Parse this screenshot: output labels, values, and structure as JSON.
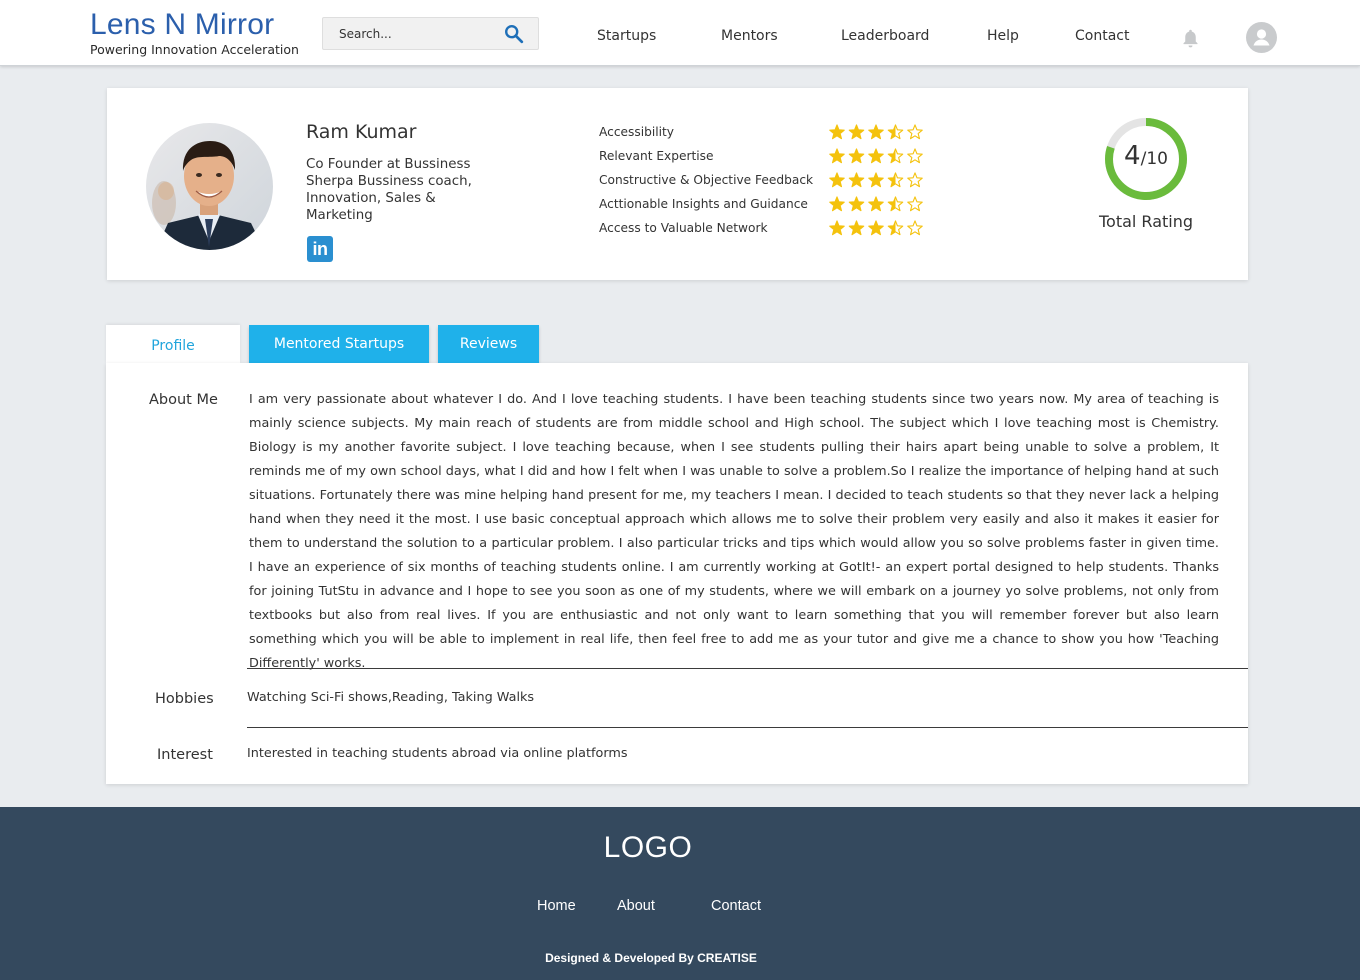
{
  "header": {
    "brand_title": "Lens N Mirror",
    "brand_tagline": "Powering Innovation Acceleration",
    "search_placeholder": "Search...",
    "search_icon": "search-icon",
    "nav": [
      "Startups",
      "Mentors",
      "Leaderboard",
      "Help",
      "Contact"
    ],
    "notification_icon": "bell-icon",
    "profile_icon": "user-avatar-icon",
    "brand_color": "#2b5fac"
  },
  "profile": {
    "name": "Ram Kumar",
    "role": "Co Founder at Bussiness Sherpa Bussiness coach, Innovation, Sales & Marketing",
    "linkedin_text": "in",
    "linkedin_icon": "linkedin-icon",
    "criteria": [
      {
        "label": "Accessibility",
        "stars": 3.5,
        "max": 5
      },
      {
        "label": "Relevant Expertise",
        "stars": 3.5,
        "max": 5
      },
      {
        "label": "Constructive & Objective Feedback",
        "stars": 3.5,
        "max": 5
      },
      {
        "label": "Acttionable Insights and Guidance",
        "stars": 3.5,
        "max": 5
      },
      {
        "label": "Access to Valuable Network",
        "stars": 3.5,
        "max": 5
      }
    ],
    "star_color": "#f4c20d",
    "total_rating": {
      "value": "4",
      "max": "/10",
      "label": "Total Rating",
      "fraction": 0.8,
      "ring_color": "#6abb3c",
      "track_color": "#e4e4e4"
    }
  },
  "tabs": [
    "Profile",
    "Mentored Startups",
    "Reviews"
  ],
  "active_tab": "Profile",
  "accent_color": "#1fb1ea",
  "sections": {
    "about_label": "About Me",
    "about_text": "I am very passionate about whatever I do. And I love teaching students. I have been teaching students since two years now. My area of teaching is mainly science subjects. My main reach of students are from middle school and High school. The subject which I love teaching most is Chemistry. Biology is my another favorite subject. I love teaching because, when I see students pulling their hairs apart being unable to solve a problem, It reminds me of my own school days, what I did and how I felt when I was unable to solve a problem.So I realize the importance of helping hand at such situations. Fortunately there was mine helping hand present for me, my teachers I mean. I decided to teach students so that they never lack a helping hand when they need it the most. I use basic conceptual approach which allows me to solve their problem very easily and also it makes it easier for them to understand the solution to a particular problem. I also particular tricks and tips which would allow you so solve problems faster in given time. I have an experience of six months of teaching students online. I am currently working at GotIt!- an expert portal designed to help students. Thanks for joining TutStu in advance and I hope to see you soon as one of my students, where we will embark on a journey yo solve problems, not only from textbooks but also from real lives. If you are enthusiastic and not only want to learn something that you will remember forever but also learn something which you will be able to implement in real life, then feel free to add me as your tutor and give me a chance to show you how 'Teaching Differently' works.",
    "hobbies_label": "Hobbies",
    "hobbies_text": "Watching Sci-Fi shows,Reading, Taking Walks",
    "interest_label": "Interest",
    "interest_text": "Interested in teaching students abroad via online platforms"
  },
  "footer": {
    "logo": "LOGO",
    "links": [
      "Home",
      "About",
      "Contact"
    ],
    "credit": "Designed & Developed By CREATISE",
    "background": "#34495e"
  }
}
